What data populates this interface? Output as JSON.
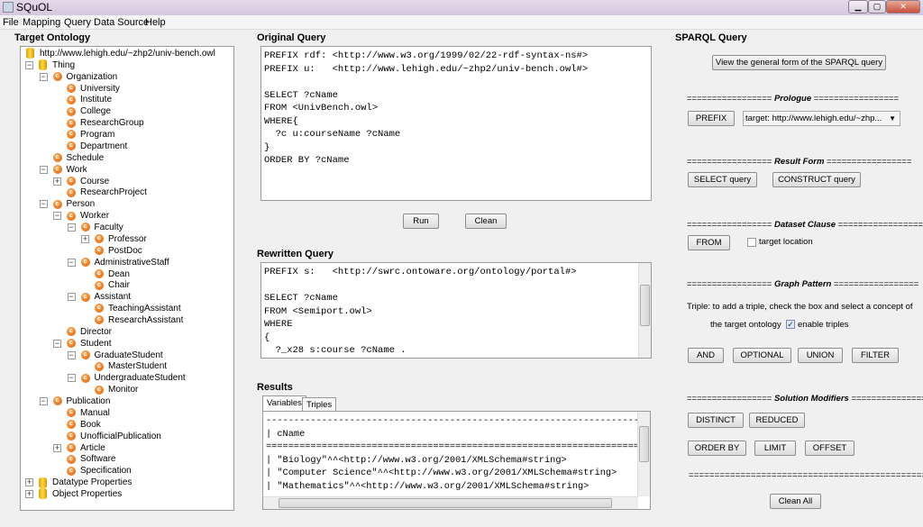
{
  "window": {
    "title": "SQuOL"
  },
  "menu": [
    "File",
    "Mapping",
    "Query",
    "Data Source",
    "Help"
  ],
  "left": {
    "title": "Target Ontology",
    "tree": [
      {
        "label": "http://www.lehigh.edu/~zhp2/univ-bench.owl",
        "level": 0,
        "icon": "database-icon",
        "exp": ""
      },
      {
        "label": "Thing",
        "level": 0,
        "icon": "database-icon",
        "exp": "-"
      },
      {
        "label": "Organization",
        "level": 1,
        "icon": "class-icon",
        "exp": "-"
      },
      {
        "label": "University",
        "level": 2,
        "icon": "class-icon",
        "exp": ""
      },
      {
        "label": "Institute",
        "level": 2,
        "icon": "class-icon",
        "exp": ""
      },
      {
        "label": "College",
        "level": 2,
        "icon": "class-icon",
        "exp": ""
      },
      {
        "label": "ResearchGroup",
        "level": 2,
        "icon": "class-icon",
        "exp": ""
      },
      {
        "label": "Program",
        "level": 2,
        "icon": "class-icon",
        "exp": ""
      },
      {
        "label": "Department",
        "level": 2,
        "icon": "class-icon",
        "exp": ""
      },
      {
        "label": "Schedule",
        "level": 1,
        "icon": "class-icon",
        "exp": ""
      },
      {
        "label": "Work",
        "level": 1,
        "icon": "class-icon",
        "exp": "-"
      },
      {
        "label": "Course",
        "level": 2,
        "icon": "class-icon",
        "exp": "+"
      },
      {
        "label": "ResearchProject",
        "level": 2,
        "icon": "class-icon",
        "exp": ""
      },
      {
        "label": "Person",
        "level": 1,
        "icon": "class-icon",
        "exp": "-"
      },
      {
        "label": "Worker",
        "level": 2,
        "icon": "class-icon",
        "exp": "-"
      },
      {
        "label": "Faculty",
        "level": 3,
        "icon": "class-icon",
        "exp": "-"
      },
      {
        "label": "Professor",
        "level": 4,
        "icon": "class-icon",
        "exp": "+"
      },
      {
        "label": "PostDoc",
        "level": 4,
        "icon": "class-icon",
        "exp": ""
      },
      {
        "label": "AdministrativeStaff",
        "level": 3,
        "icon": "class-icon",
        "exp": "-"
      },
      {
        "label": "Dean",
        "level": 4,
        "icon": "class-icon",
        "exp": ""
      },
      {
        "label": "Chair",
        "level": 4,
        "icon": "class-icon",
        "exp": ""
      },
      {
        "label": "Assistant",
        "level": 3,
        "icon": "class-icon",
        "exp": "-"
      },
      {
        "label": "TeachingAssistant",
        "level": 4,
        "icon": "class-icon",
        "exp": ""
      },
      {
        "label": "ResearchAssistant",
        "level": 4,
        "icon": "class-icon",
        "exp": ""
      },
      {
        "label": "Director",
        "level": 2,
        "icon": "class-icon",
        "exp": ""
      },
      {
        "label": "Student",
        "level": 2,
        "icon": "class-icon",
        "exp": "-"
      },
      {
        "label": "GraduateStudent",
        "level": 3,
        "icon": "class-icon",
        "exp": "-"
      },
      {
        "label": "MasterStudent",
        "level": 4,
        "icon": "class-icon",
        "exp": ""
      },
      {
        "label": "UndergraduateStudent",
        "level": 3,
        "icon": "class-icon",
        "exp": "-"
      },
      {
        "label": "Monitor",
        "level": 4,
        "icon": "class-icon",
        "exp": ""
      },
      {
        "label": "Publication",
        "level": 1,
        "icon": "class-icon",
        "exp": "-"
      },
      {
        "label": "Manual",
        "level": 2,
        "icon": "class-icon",
        "exp": ""
      },
      {
        "label": "Book",
        "level": 2,
        "icon": "class-icon",
        "exp": ""
      },
      {
        "label": "UnofficialPublication",
        "level": 2,
        "icon": "class-icon",
        "exp": ""
      },
      {
        "label": "Article",
        "level": 2,
        "icon": "class-icon",
        "exp": "+"
      },
      {
        "label": "Software",
        "level": 2,
        "icon": "class-icon",
        "exp": ""
      },
      {
        "label": "Specification",
        "level": 2,
        "icon": "class-icon",
        "exp": ""
      },
      {
        "label": "Datatype Properties",
        "level": 0,
        "icon": "database-icon",
        "exp": "+"
      },
      {
        "label": "Object Properties",
        "level": 0,
        "icon": "database-icon",
        "exp": "+"
      }
    ]
  },
  "original": {
    "title": "Original Query",
    "text": "PREFIX rdf: <http://www.w3.org/1999/02/22-rdf-syntax-ns#>\nPREFIX u:   <http://www.lehigh.edu/~zhp2/univ-bench.owl#>\n\nSELECT ?cName\nFROM <UnivBench.owl>\nWHERE{\n  ?c u:courseName ?cName\n}\nORDER BY ?cName",
    "run": "Run",
    "clean": "Clean"
  },
  "rewritten": {
    "title": "Rewritten Query",
    "text": "PREFIX s:   <http://swrc.ontoware.org/ontology/portal#>\n\nSELECT ?cName\nFROM <Semiport.owl>\nWHERE\n{\n  ?_x28 s:course ?cName ."
  },
  "results": {
    "title": "Results",
    "tabs": [
      "Variables",
      "Triples"
    ],
    "text": "-------------------------------------------------------------------------------\n| cName\n===============================================================================\n| \"Biology\"^^<http://www.w3.org/2001/XMLSchema#string>\n| \"Computer Science\"^^<http://www.w3.org/2001/XMLSchema#string>\n| \"Mathematics\"^^<http://www.w3.org/2001/XMLSchema#string>"
  },
  "sparql": {
    "title": "SPARQL Query",
    "general": "View the general form of the SPARQL query",
    "prologue": "Prologue",
    "prefix": "PREFIX",
    "prefix_select": "target: http://www.lehigh.edu/~zhp...",
    "result_form": "Result Form",
    "select": "SELECT query",
    "construct": "CONSTRUCT query",
    "dataset": "Dataset Clause",
    "from": "FROM",
    "target_location": "target location",
    "graph": "Graph Pattern",
    "triple_hint1": "Triple: to add a triple, check the box and select a concept of",
    "triple_hint2": "the target ontology",
    "enable_triples": "enable triples",
    "enable_checked": true,
    "and": "AND",
    "optional": "OPTIONAL",
    "union": "UNION",
    "filter": "FILTER",
    "modifiers": "Solution Modifiers",
    "distinct": "DISTINCT",
    "reduced": "REDUCED",
    "orderby": "ORDER BY",
    "limit": "LIMIT",
    "offset": "OFFSET",
    "clean_all": "Clean All",
    "eq": "================="
  }
}
